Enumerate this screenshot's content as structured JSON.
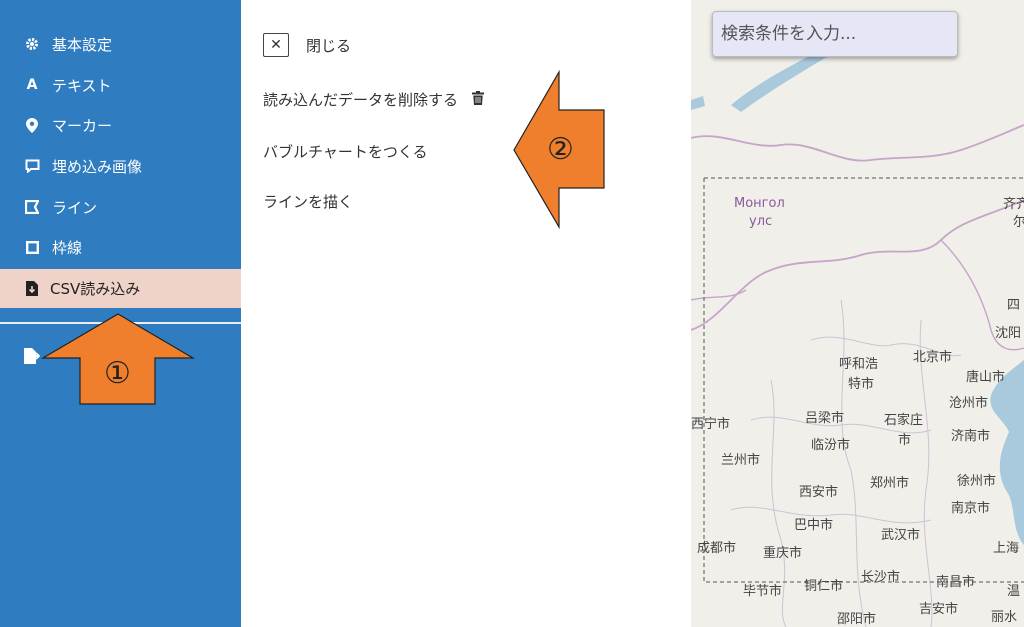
{
  "sidebar": {
    "items": [
      {
        "label": "基本設定",
        "icon": "gear-icon"
      },
      {
        "label": "テキスト",
        "icon": "font-a-icon"
      },
      {
        "label": "マーカー",
        "icon": "map-marker-icon"
      },
      {
        "label": "埋め込み画像",
        "icon": "comment-icon"
      },
      {
        "label": "ライン",
        "icon": "line-flag-icon"
      },
      {
        "label": "枠線",
        "icon": "square-frame-icon"
      },
      {
        "label": "CSV読み込み",
        "icon": "file-import-icon"
      }
    ],
    "export_icon": "file-export-icon"
  },
  "panel": {
    "close_label": "閉じる",
    "delete_label": "読み込んだデータを削除する",
    "bubble_label": "バブルチャートをつくる",
    "line_label": "ラインを描く"
  },
  "map": {
    "search_placeholder": "検索条件を入力...",
    "labels": {
      "mongol1": "Монгол",
      "mongol2": "улс",
      "qi": "齐齐",
      "qi2": "尔",
      "si": "四",
      "shenyang": "沈阳",
      "hohhot1": "呼和浩",
      "hohhot2": "特市",
      "beijing": "北京市",
      "tangshan": "唐山市",
      "cangzhou": "沧州市",
      "xining": "西宁市",
      "lvliang": "吕梁市",
      "shijiazhuang1": "石家庄",
      "shijiazhuang2": "市",
      "linfen": "临汾市",
      "jinan": "济南市",
      "lanzhou": "兰州市",
      "xian": "西安市",
      "zhengzhou": "郑州市",
      "xuzhou": "徐州市",
      "nanjing": "南京市",
      "bazhong": "巴中市",
      "wuhan": "武汉市",
      "shanghai": "上海",
      "chengdu": "成都市",
      "chongqing": "重庆市",
      "changsha": "长沙市",
      "nanchang": "南昌市",
      "bijie": "毕节市",
      "tongren": "铜仁市",
      "wen": "温",
      "jian": "吉安市",
      "shaoyang": "邵阳市",
      "lishui": "丽水"
    }
  },
  "annotations": {
    "arrow1_label": "①",
    "arrow2_label": "②",
    "arrow_color": "#ef7f2c"
  },
  "colors": {
    "sidebar_bg": "#2f7dc0",
    "active_bg": "#efd3c9",
    "search_bg": "#e6e6f6"
  }
}
